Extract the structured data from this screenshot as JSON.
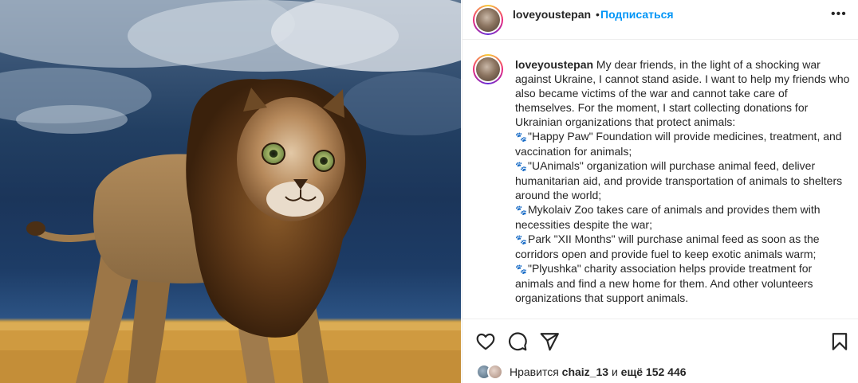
{
  "post": {
    "username": "loveyoustepan",
    "separator": "•",
    "follow_label": "Подписаться",
    "more_label": "•••",
    "media_alt": "cat head on lion body in wheat field"
  },
  "caption": {
    "username": "loveyoustepan",
    "intro": "My dear friends, in the light of a shocking war against Ukraine, I cannot stand aside. I want to help my friends who also became victims of the war and cannot take care of themselves. For the moment, I start collecting donations for Ukrainian organizations that protect animals:",
    "items": [
      "\"Happy Paw\" Foundation will provide medicines, treatment, and vaccination for animals;",
      "\"UAnimals\" organization will purchase animal feed, deliver humanitarian aid, and provide transportation of animals to shelters around the world;",
      "Mykolaiv Zoo takes care of animals and provides them with necessities despite the war;",
      "Park \"XII Months\" will purchase animal feed as soon as the corridors open and provide fuel to keep exotic animals warm;",
      "\"Plyushka\" charity association helps provide treatment for animals and find a new home for them. And other volunteers organizations that support animals."
    ],
    "bullet_icon": "paw-prints-icon"
  },
  "actions": {
    "like_icon": "heart-icon",
    "comment_icon": "comment-icon",
    "share_icon": "send-icon",
    "save_icon": "bookmark-icon"
  },
  "likes": {
    "prefix": "Нравится",
    "user": "chaiz_13",
    "middle": "и",
    "rest": "ещё 152 446"
  },
  "colors": {
    "link_blue": "#0095f6",
    "text": "#262626",
    "border": "#efefef"
  }
}
